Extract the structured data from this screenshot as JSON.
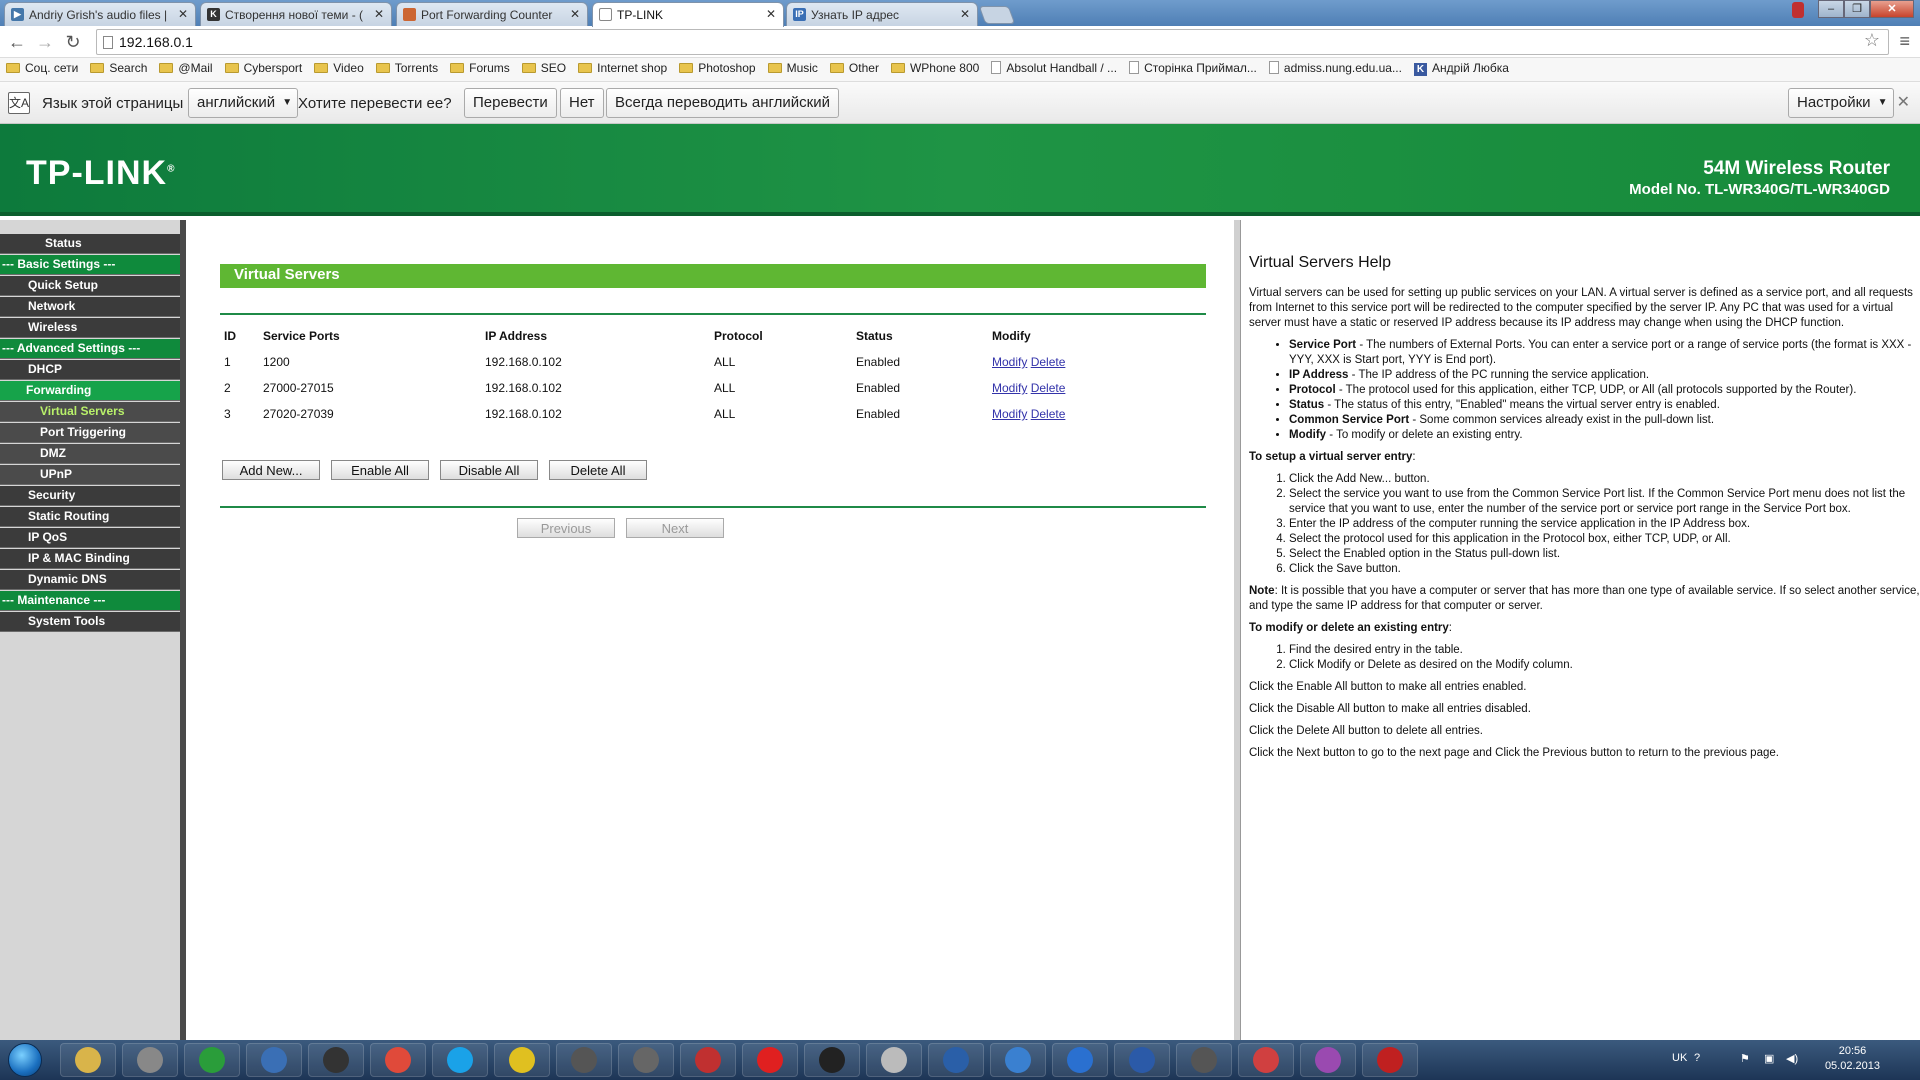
{
  "browser": {
    "tabs": [
      {
        "title": "Andriy Grish's audio files |",
        "icon": "media-icon",
        "color": "#3366aa"
      },
      {
        "title": "Створення нової теми - (",
        "icon": "k-icon",
        "color": "#333333"
      },
      {
        "title": "Port Forwarding Counter",
        "icon": "page-icon",
        "color": "#cc6633"
      },
      {
        "title": "TP-LINK",
        "icon": "page-icon",
        "color": "#888888"
      },
      {
        "title": "Узнать IP адрес",
        "icon": "ip-icon",
        "color": "#3a6fb5"
      }
    ],
    "url": "192.168.0.1",
    "bookmarks": [
      {
        "label": "Соц. сети",
        "type": "folder"
      },
      {
        "label": "Search",
        "type": "folder"
      },
      {
        "label": "@Mail",
        "type": "folder"
      },
      {
        "label": "Cybersport",
        "type": "folder"
      },
      {
        "label": "Video",
        "type": "folder"
      },
      {
        "label": "Torrents",
        "type": "folder"
      },
      {
        "label": "Forums",
        "type": "folder"
      },
      {
        "label": "SEO",
        "type": "folder"
      },
      {
        "label": "Internet shop",
        "type": "folder"
      },
      {
        "label": "Photoshop",
        "type": "folder"
      },
      {
        "label": "Music",
        "type": "folder"
      },
      {
        "label": "Other",
        "type": "folder"
      },
      {
        "label": "WPhone 800",
        "type": "folder"
      },
      {
        "label": "Absolut Handball / ...",
        "type": "page"
      },
      {
        "label": "Сторінка Приймал...",
        "type": "page"
      },
      {
        "label": "admiss.nung.edu.ua...",
        "type": "page"
      },
      {
        "label": "Андрій Любка",
        "type": "k"
      }
    ],
    "translate": {
      "lang_label": "Язык этой страницы",
      "lang_value": "английский",
      "question": "Хотите перевести ее?",
      "translate_btn": "Перевести",
      "no_btn": "Нет",
      "always_btn": "Всегда переводить английский",
      "settings_btn": "Настройки"
    }
  },
  "router": {
    "logo": "TP-LINK",
    "product": "54M Wireless Router",
    "model": "Model No. TL-WR340G/TL-WR340GD",
    "menu": [
      {
        "label": "Status",
        "kind": "item"
      },
      {
        "label": "--- Basic Settings ---",
        "kind": "section"
      },
      {
        "label": "Quick Setup",
        "kind": "item"
      },
      {
        "label": "Network",
        "kind": "item"
      },
      {
        "label": "Wireless",
        "kind": "item"
      },
      {
        "label": "--- Advanced Settings ---",
        "kind": "section"
      },
      {
        "label": "DHCP",
        "kind": "item"
      },
      {
        "label": "Forwarding",
        "kind": "current"
      },
      {
        "label": "Virtual Servers",
        "kind": "sub-selected"
      },
      {
        "label": "Port Triggering",
        "kind": "sub"
      },
      {
        "label": "DMZ",
        "kind": "sub"
      },
      {
        "label": "UPnP",
        "kind": "sub"
      },
      {
        "label": "Security",
        "kind": "item"
      },
      {
        "label": "Static Routing",
        "kind": "item"
      },
      {
        "label": "IP QoS",
        "kind": "item"
      },
      {
        "label": "IP & MAC Binding",
        "kind": "item"
      },
      {
        "label": "Dynamic DNS",
        "kind": "item"
      },
      {
        "label": "--- Maintenance ---",
        "kind": "section"
      },
      {
        "label": "System Tools",
        "kind": "item"
      }
    ],
    "page_title": "Virtual Servers",
    "columns": [
      "ID",
      "Service Ports",
      "IP Address",
      "Protocol",
      "Status",
      "Modify"
    ],
    "rows": [
      {
        "id": "1",
        "ports": "1200",
        "ip": "192.168.0.102",
        "protocol": "ALL",
        "status": "Enabled",
        "modify": "Modify",
        "delete": "Delete"
      },
      {
        "id": "2",
        "ports": "27000-27015",
        "ip": "192.168.0.102",
        "protocol": "ALL",
        "status": "Enabled",
        "modify": "Modify",
        "delete": "Delete"
      },
      {
        "id": "3",
        "ports": "27020-27039",
        "ip": "192.168.0.102",
        "protocol": "ALL",
        "status": "Enabled",
        "modify": "Modify",
        "delete": "Delete"
      }
    ],
    "buttons": {
      "add_new": "Add New...",
      "enable_all": "Enable All",
      "disable_all": "Disable All",
      "delete_all": "Delete All",
      "previous": "Previous",
      "next": "Next"
    }
  },
  "help": {
    "title": "Virtual Servers Help",
    "intro": "Virtual servers can be used for setting up public services on your LAN. A virtual server is defined as a service port, and all requests from Internet to this service port will be redirected to the computer specified by the server IP. Any PC that was used for a virtual server must have a static or reserved IP address because its IP address may change when using the DHCP function.",
    "fields": [
      {
        "term": "Service Port",
        "text": " - The numbers of External Ports. You can enter a service port or a range of service ports (the format is XXX - YYY, XXX is Start port, YYY is End port)."
      },
      {
        "term": "IP Address",
        "text": " - The IP address of the PC running the service application."
      },
      {
        "term": "Protocol",
        "text": " - The protocol used for this application, either TCP, UDP, or All (all protocols supported by the Router)."
      },
      {
        "term": "Status",
        "text": " - The status of this entry, \"Enabled\" means the virtual server entry is enabled."
      },
      {
        "term": "Common Service Port",
        "text": " - Some common services already exist in the pull-down list."
      },
      {
        "term": "Modify",
        "text": " - To modify or delete an existing entry."
      }
    ],
    "setup_heading": "To setup a virtual server entry",
    "setup_steps": [
      "Click the Add New... button.",
      "Select the service you want to use from the Common Service Port list. If the Common Service Port menu does not list the service that you want to use, enter the number of the service port or service port range in the Service Port box.",
      "Enter the IP address of the computer running the service application in the IP Address box.",
      "Select the protocol used for this application in the Protocol box, either TCP, UDP, or All.",
      "Select the Enabled option in the Status pull-down list.",
      "Click the Save button."
    ],
    "note_label": "Note",
    "note": ": It is possible that you have a computer or server that has more than one type of available service. If so select another service, and type the same IP address for that computer or server.",
    "modify_heading": "To modify or delete an existing entry",
    "modify_steps": [
      "Find the desired entry in the table.",
      "Click Modify or Delete as desired on the Modify column."
    ],
    "enable_all": "Click the Enable All button to make all entries enabled.",
    "disable_all": "Click the Disable All button to make all entries disabled.",
    "delete_all": "Click the Delete All button to delete all entries.",
    "nav": "Click the Next button to go to the next page and Click the Previous button to return to the previous page."
  },
  "taskbar": {
    "apps": [
      "explorer-icon",
      "media-player-icon",
      "utorrent-icon",
      "audio-icon",
      "steam-icon",
      "chrome-icon",
      "skype-icon",
      "game-icon",
      "app99-icon",
      "app99b-icon",
      "app-red-icon",
      "opera-icon",
      "terminal-icon",
      "cow-icon",
      "photoshop-icon",
      "moon-icon",
      "flash-icon",
      "word-icon",
      "eye-icon",
      "star-icon",
      "image-icon",
      "acrobat-icon"
    ],
    "lang": "UK",
    "time": "20:56",
    "date": "05.02.2013"
  }
}
